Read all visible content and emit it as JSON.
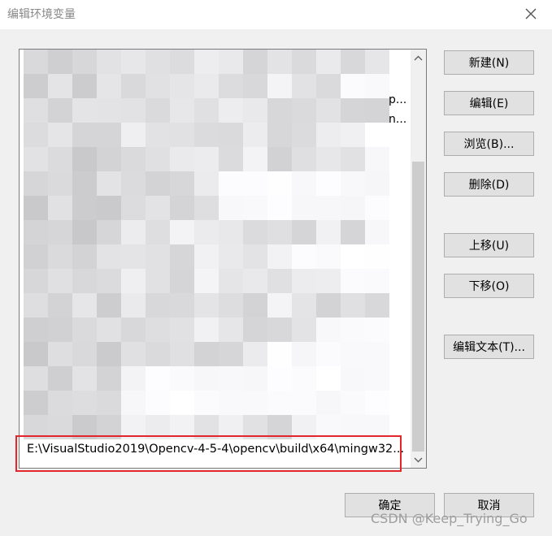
{
  "window": {
    "title": "编辑环境变量"
  },
  "list": {
    "truncated_items": [
      "p...",
      "n..."
    ],
    "selected_item": "E:\\VisualStudio2019\\Opencv-4-5-4\\opencv\\build\\x64\\mingw32..."
  },
  "buttons": {
    "new": "新建(N)",
    "edit": "编辑(E)",
    "browse": "浏览(B)...",
    "delete": "删除(D)",
    "move_up": "上移(U)",
    "move_down": "下移(O)",
    "edit_text": "编辑文本(T)...",
    "ok": "确定",
    "cancel": "取消"
  },
  "watermark": "CSDN @Keep_Trying_Go",
  "colors": {
    "highlight_box": "#e3262b",
    "button_face": "#e1e1e1",
    "dialog_bg": "#f0f0f0"
  }
}
